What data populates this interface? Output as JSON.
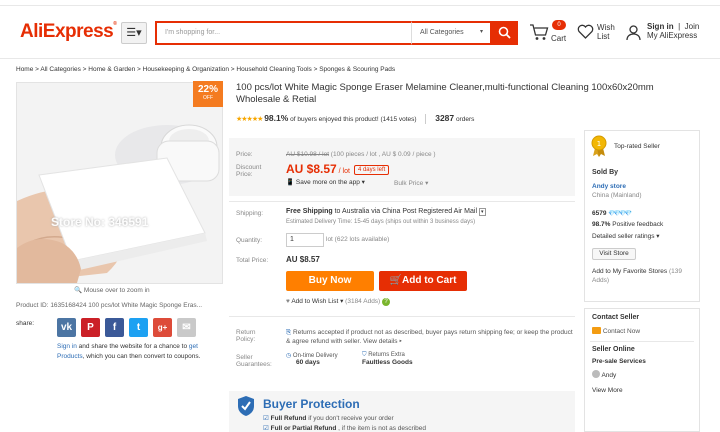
{
  "header": {
    "logo": "AliExpress",
    "logo_mark": "®",
    "categories_button": "☰▾",
    "search_placeholder": "I'm shopping for...",
    "category_select": "All Categories",
    "cart_count": "0",
    "cart_label": "Cart",
    "wish_label_1": "Wish",
    "wish_label_2": "List",
    "signin": "Sign in",
    "join": "Join",
    "my_aliexpress": "My AliExpress"
  },
  "breadcrumb": "Home > All Categories > Home & Garden > Housekeeping & Organization > Household Cleaning Tools > Sponges & Scouring Pads",
  "gallery": {
    "discount_pct": "22%",
    "discount_off": "OFF",
    "watermark_1": "Store No: 346591",
    "watermark_2": "Store No: 346591",
    "zoom_note": "Mouse over to zoom in",
    "product_id": "Product ID: 1635168424 100 pcs/lot White Magic Sponge Eras..."
  },
  "share": {
    "label": "share:",
    "icons": [
      "vk",
      "P",
      "f",
      "t",
      "g+",
      "✉"
    ],
    "signin": "Sign in",
    "text_1": " and share the website for a chance to ",
    "get": "get",
    "text_2": "Products",
    "text_3": ", which you can then convert to coupons."
  },
  "product": {
    "title": "100 pcs/lot White Magic Sponge Eraser Melamine Cleaner,multi-functional Cleaning 100x60x20mm Wholesale & Retial",
    "stars": "★★★★★",
    "rating_pct": "98.1%",
    "rating_text": " of buyers enjoyed this product! (1415 votes)",
    "orders_count": "3287",
    "orders_label": " orders"
  },
  "price": {
    "price_label": "Price:",
    "old_price": "AU $10.98 / lot",
    "old_note": "  (100 pieces / lot , AU $ 0.09 / piece )",
    "discount_label_1": "Discount",
    "discount_label_2": "Price:",
    "new_price": "AU $8.57",
    "unit": " / lot",
    "days_left": "4 days left",
    "save_app": "Save more on the app ▾",
    "bulk": "Bulk Price ▾"
  },
  "shipping": {
    "label": "Shipping:",
    "free": "Free Shipping",
    "to": " to ",
    "country": "Australia via China Post Registered Air Mail",
    "note": "Estimated Delivery Time: 15-45 days (ships out within 3 business days)"
  },
  "quantity": {
    "label": "Quantity:",
    "value": "1",
    "note": "lot (622 lots available)"
  },
  "total": {
    "label": "Total Price:",
    "value": "AU $8.57"
  },
  "actions": {
    "buy_now": "Buy Now",
    "add_to_cart": "Add to Cart",
    "wish": "Add to Wish List ▾",
    "wish_count": "(3184 Adds)"
  },
  "returns": {
    "label_1": "Return",
    "label_2": "Policy:",
    "text": "Returns accepted if product not as described, buyer pays return shipping fee; or keep the product & agree refund with seller.",
    "link": " View details ▸"
  },
  "guarantees": {
    "label_1": "Seller",
    "label_2": "Guarantees:",
    "g1_title": "On-time Delivery",
    "g1_value": "60 days",
    "g2_title": "Returns Extra",
    "g2_value": "Faultless Goods"
  },
  "buyer_protection": {
    "title": "Buyer Protection",
    "line1_bold": "Full Refund",
    "line1_rest": " if you don't receive your order",
    "line2_bold": "Full or Partial Refund",
    "line2_rest": " , if the item is not as described"
  },
  "seller": {
    "badge": "Top-rated Seller",
    "sold_by": "Sold By",
    "store": "Andy store",
    "location": "China (Mainland)",
    "score": "6579",
    "diamonds": "💎💎💎💎",
    "feedback_pct": "98.7%",
    "feedback_label": " Positive feedback",
    "ratings": "Detailed seller ratings ▾",
    "visit": "Visit Store",
    "fav_1": "Add to My Favorite Stores",
    "fav_count": " (139",
    "fav_2": "Adds)"
  },
  "contact": {
    "title": "Contact Seller",
    "link": "Contact Now",
    "online": "Seller Online",
    "presale": "Pre-sale Services",
    "name": "Andy",
    "more": "View More"
  },
  "colors": {
    "brand": "#e62e04",
    "orange": "#ff7f00",
    "link": "#2d6db5"
  }
}
